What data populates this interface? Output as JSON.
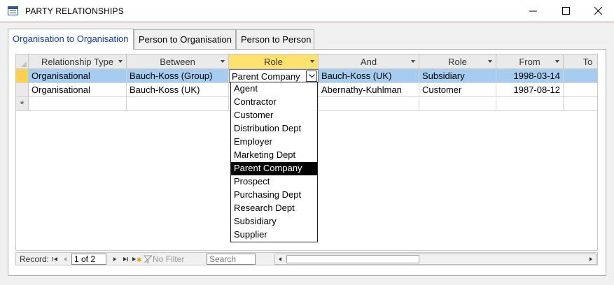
{
  "window": {
    "title": "PARTY RELATIONSHIPS"
  },
  "tabs": [
    {
      "label": "Organisation to Organisation",
      "active": true
    },
    {
      "label": "Person to Organisation",
      "active": false
    },
    {
      "label": "Person to Person",
      "active": false
    }
  ],
  "grid": {
    "columns": [
      "Relationship Type",
      "Between",
      "Role",
      "And",
      "Role",
      "From",
      "To"
    ],
    "rows": [
      {
        "relationship_type": "Organisational",
        "between": "Bauch-Koss (Group)",
        "role1": "Parent Company",
        "and": "Bauch-Koss (UK)",
        "role2": "Subsidiary",
        "from": "1998-03-14"
      },
      {
        "relationship_type": "Organisational",
        "between": "Bauch-Koss (UK)",
        "role1": "",
        "and": "Abernathy-Kuhlman",
        "role2": "Customer",
        "from": "1987-08-12"
      }
    ],
    "new_row_marker": "*"
  },
  "role_dropdown": {
    "selected": "Parent Company",
    "options": [
      "Agent",
      "Contractor",
      "Customer",
      "Distribution Dept",
      "Employer",
      "Marketing Dept",
      "Parent Company",
      "Prospect",
      "Purchasing Dept",
      "Research Dept",
      "Subsidiary",
      "Supplier"
    ]
  },
  "navigation": {
    "record_label": "Record:",
    "record_position": "1 of 2",
    "no_filter_label": "No Filter",
    "search_placeholder": "Search"
  },
  "colors": {
    "selected_row": "#a6cdf0",
    "selected_header": "#ffe26d",
    "active_tab_text": "#0b3ea8"
  }
}
